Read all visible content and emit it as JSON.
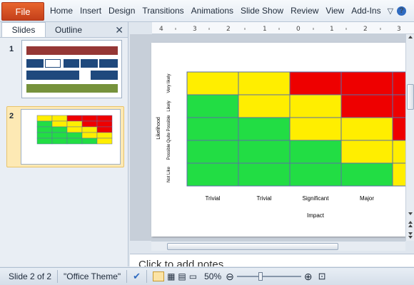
{
  "ribbon": {
    "file_label": "File",
    "tabs": [
      "Home",
      "Insert",
      "Design",
      "Transitions",
      "Animations",
      "Slide Show",
      "Review",
      "View",
      "Add-Ins"
    ]
  },
  "left_pane": {
    "tabs": [
      "Slides",
      "Outline"
    ],
    "active_tab": "Slides",
    "slides": [
      {
        "number": "1"
      },
      {
        "number": "2"
      }
    ]
  },
  "notes": {
    "placeholder": "Click to add notes"
  },
  "status": {
    "slide_info": "Slide 2 of 2",
    "theme": "\"Office Theme\"",
    "zoom": "50%"
  },
  "chart_data": {
    "type": "heatmap",
    "title": "",
    "xlabel": "Impact",
    "ylabel": "Likelihood",
    "x_categories": [
      "Trivial",
      "Trivial",
      "Significant",
      "Major",
      ""
    ],
    "y_categories": [
      "Very likely",
      "Likely",
      "Quite Possible",
      "Possible",
      "Not Like"
    ],
    "colors": {
      "green": "#22dd44",
      "yellow": "#ffee00",
      "red": "#ee0000"
    },
    "grid": [
      [
        "yellow",
        "yellow",
        "red",
        "red",
        "red"
      ],
      [
        "green",
        "yellow",
        "yellow",
        "red",
        "red"
      ],
      [
        "green",
        "green",
        "yellow",
        "yellow",
        "red"
      ],
      [
        "green",
        "green",
        "green",
        "yellow",
        "yellow"
      ],
      [
        "green",
        "green",
        "green",
        "green",
        "yellow"
      ]
    ]
  }
}
